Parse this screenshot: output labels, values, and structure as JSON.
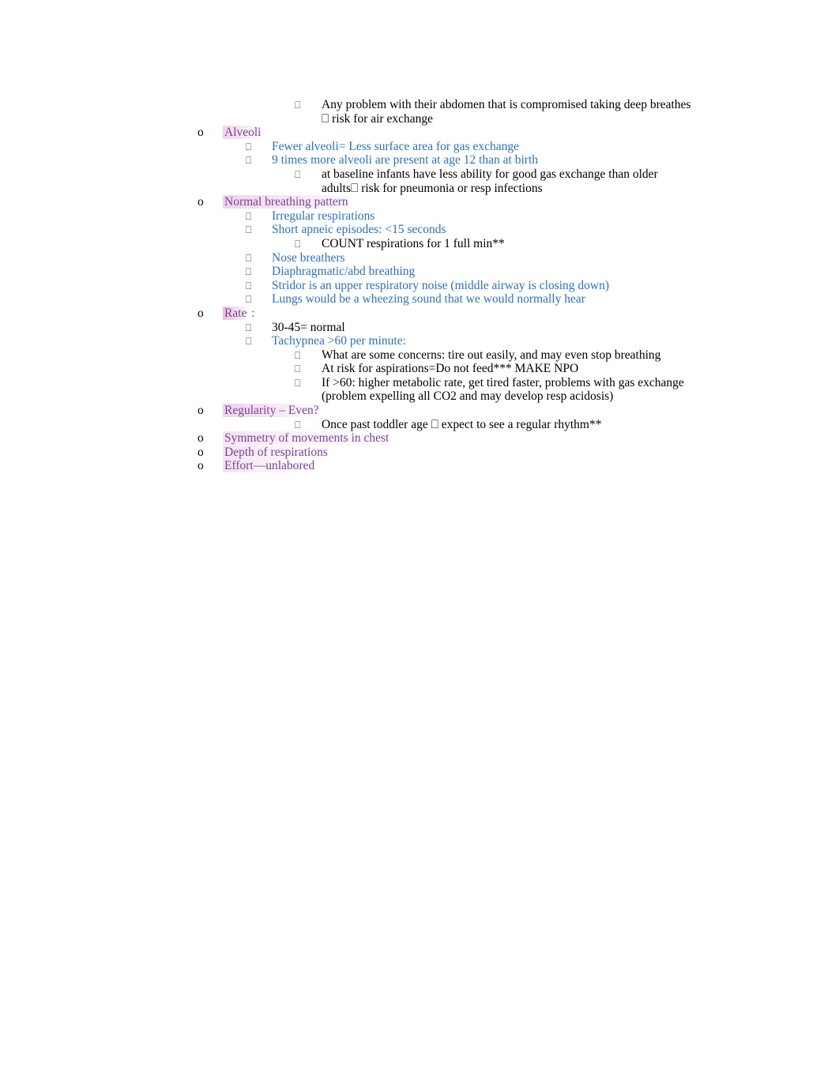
{
  "document": {
    "title": "Pediatric Respiratory Assessment Notes",
    "colors": {
      "black": "#000000",
      "blue": "#2b72b8",
      "purple": "#7b3fa0",
      "highlight_pink": "#ecc8e2"
    },
    "bullet_glyphs": {
      "level1": "o",
      "level2": "⎕",
      "level3": "⎕",
      "inline_arrow": "⎕"
    }
  },
  "outline": [
    {
      "id": "abdomen-problem",
      "level": 3,
      "color": "black",
      "highlight": "none",
      "text": "Any problem with their abdomen that is compromised taking deep breathes",
      "continuation": "⎕ risk for air exchange"
    },
    {
      "id": "alveoli",
      "level": 1,
      "color": "purple",
      "highlight": "pink",
      "text": "Alveoli"
    },
    {
      "id": "fewer-alveoli",
      "level": 2,
      "color": "blue",
      "highlight": "none",
      "text": "Fewer alveoli= Less surface area for gas exchange"
    },
    {
      "id": "nine-times-more-alveoli",
      "level": 2,
      "color": "blue",
      "highlight": "none",
      "text": "9 times more alveoli are present at age 12 than at birth"
    },
    {
      "id": "baseline-infants",
      "level": 3,
      "color": "black",
      "highlight": "none",
      "text": "at baseline infants have less ability for good gas exchange than older",
      "continuation": "adults⎕ risk for pneumonia or resp infections"
    },
    {
      "id": "normal-breathing-pattern",
      "level": 1,
      "color": "purple",
      "highlight": "pink",
      "text": "Normal breathing pattern"
    },
    {
      "id": "irregular-respirations",
      "level": 2,
      "color": "blue",
      "highlight": "none",
      "text": "Irregular respirations"
    },
    {
      "id": "short-apneic-episodes",
      "level": 2,
      "color": "blue",
      "highlight": "none",
      "text": "Short apneic episodes: <15 seconds"
    },
    {
      "id": "count-respirations",
      "level": 3,
      "color": "black",
      "highlight": "none",
      "text": "COUNT respirations for 1 full min**"
    },
    {
      "id": "nose-breathers",
      "level": 2,
      "color": "blue",
      "highlight": "none",
      "text": "Nose breathers"
    },
    {
      "id": "diaphragmatic-abd-breathing",
      "level": 2,
      "color": "blue",
      "highlight": "none",
      "text": "Diaphragmatic/abd breathing"
    },
    {
      "id": "stridor",
      "level": 2,
      "color": "blue",
      "highlight": "none",
      "text": "Stridor is an upper respiratory noise (middle airway is closing down)"
    },
    {
      "id": "lungs-wheezing",
      "level": 2,
      "color": "blue",
      "highlight": "none",
      "text": "Lungs would be a wheezing sound that we would normally hear"
    },
    {
      "id": "rate",
      "level": 1,
      "color": "purple",
      "highlight": "pink-strong",
      "text": "Rate",
      "suffix": " :"
    },
    {
      "id": "thirty-to-fortyfive-normal",
      "level": 2,
      "color": "black",
      "highlight": "none",
      "text": "30-45= normal"
    },
    {
      "id": "tachypnea",
      "level": 2,
      "color": "blue",
      "highlight": "none",
      "text": "Tachypnea >60 per minute:"
    },
    {
      "id": "concerns-tire-out",
      "level": 3,
      "color": "black",
      "highlight": "none",
      "text": "What are some concerns: tire out easily, and may even stop breathing"
    },
    {
      "id": "risk-for-aspirations",
      "level": 3,
      "color": "black",
      "highlight": "none",
      "text": "At risk for aspirations=Do not feed*** MAKE NPO"
    },
    {
      "id": "if-over-sixty",
      "level": 3,
      "color": "black",
      "highlight": "none",
      "text": "If >60: higher metabolic rate, get tired faster, problems with gas exchange",
      "continuation": "(problem expelling all CO2 and may develop resp acidosis)"
    },
    {
      "id": "regularity-even",
      "level": 1,
      "color": "purple",
      "highlight": "pink",
      "text": "Regularity – Even?"
    },
    {
      "id": "once-past-toddler-age",
      "level": 3,
      "color": "black",
      "highlight": "none",
      "text": "Once past toddler age ⎕ expect to see a regular rhythm**"
    },
    {
      "id": "symmetry-of-movements",
      "level": 1,
      "color": "purple",
      "highlight": "faint",
      "text": "Symmetry of movements in chest"
    },
    {
      "id": "depth-of-respirations",
      "level": 1,
      "color": "purple",
      "highlight": "faint",
      "text": "Depth of respirations"
    },
    {
      "id": "effort-unlabored",
      "level": 1,
      "color": "purple",
      "highlight": "faint",
      "text": "Effort—unlabored"
    }
  ]
}
